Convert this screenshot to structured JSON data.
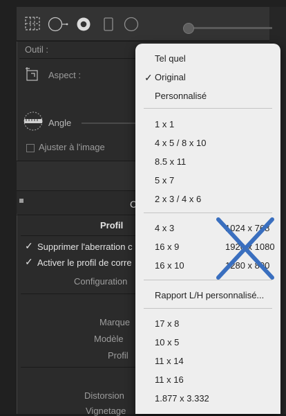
{
  "toolbar": {
    "tools": [
      "crop-grid-icon",
      "spot-circle-icon",
      "red-eye-icon",
      "graduated-filter-icon",
      "radial-filter-icon",
      "brush-icon"
    ]
  },
  "crop": {
    "tool_label": "Outil :",
    "aspect_label": "Aspect :",
    "angle_label": "Angle",
    "constrain_label": "Ajuster à l'image"
  },
  "lens": {
    "section_letter": "C",
    "tab_profile": "Profil",
    "remove_ca_label": "Supprimer l'aberration c",
    "enable_profile_label": "Activer le profil de corre",
    "setup_label": "Configuration",
    "make_label": "Marque",
    "model_label": "Modèle",
    "profile_label": "Profil",
    "distortion_label": "Distorsion",
    "vignetting_label": "Vignetage"
  },
  "menu": {
    "group1": [
      {
        "label": "Tel quel",
        "checked": false
      },
      {
        "label": "Original",
        "checked": true
      },
      {
        "label": "Personnalisé",
        "checked": false
      }
    ],
    "group2": [
      "1 x 1",
      "4 x 5  /  8 x 10",
      "8.5 x 11",
      "5 x 7",
      "2 x 3  /  4 x 6"
    ],
    "group3_left": [
      "4 x 3",
      "16 x 9",
      "16 x 10"
    ],
    "group3_right": [
      "1024 x 768",
      "1920 x 1080",
      "1280 x 800"
    ],
    "custom_ratio": "Rapport L/H personnalisé...",
    "group5": [
      "17 x 8",
      "10 x 5",
      "11 x 14",
      "11 x 16",
      "1.877 x 3.332"
    ],
    "x_mark_color": "#3a6fbf"
  }
}
